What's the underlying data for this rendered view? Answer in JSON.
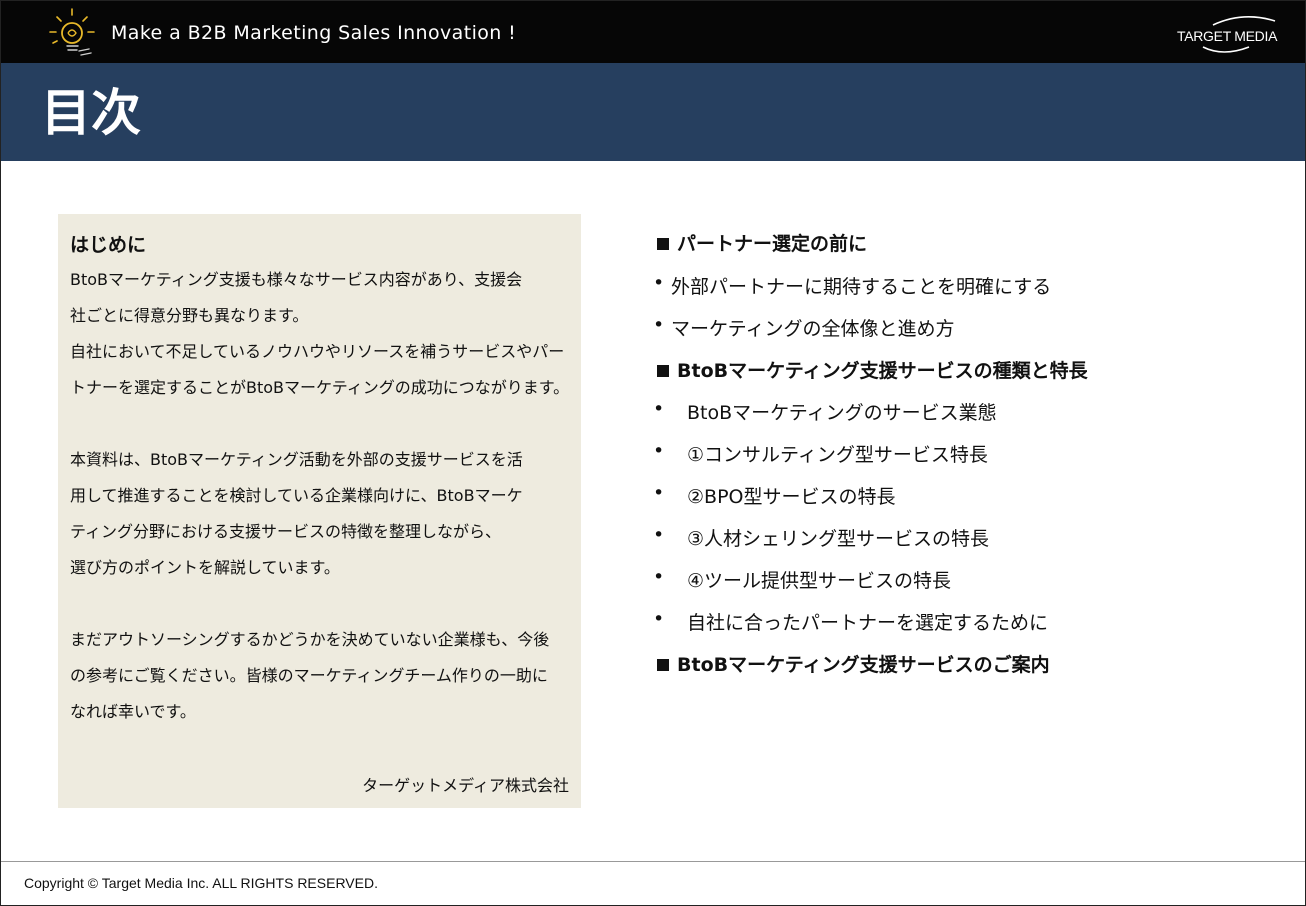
{
  "header": {
    "tagline": "Make a B2B Marketing Sales Innovation !",
    "logo_text": "TARGET MEDIA",
    "logo_icon": "lightbulb-icon"
  },
  "title": "目次",
  "intro": {
    "heading": "はじめに",
    "paragraphs": [
      [
        "BtoBマーケティング支援も様々なサービス内容があり、支援会",
        "社ごとに得意分野も異なります。",
        "自社において不足しているノウハウやリソースを補うサービスやパー",
        "トナーを選定することがBtoBマーケティングの成功につながります。"
      ],
      [
        "本資料は、BtoBマーケティング活動を外部の支援サービスを活",
        "用して推進することを検討している企業様向けに、BtoBマーケ",
        "ティング分野における支援サービスの特徴を整理しながら、",
        "選び方のポイントを解説しています。"
      ],
      [
        "まだアウトソーシングするかどうかを決めていない企業様も、今後",
        "の参考にご覧ください。皆様のマーケティングチーム作りの一助に",
        "なれば幸いです。"
      ]
    ],
    "signature": "ターゲットメディア株式会社"
  },
  "toc": [
    {
      "type": "section",
      "text": "パートナー選定の前に"
    },
    {
      "type": "bullet",
      "text": "外部パートナーに期待することを明確にする"
    },
    {
      "type": "bullet",
      "text": "マーケティングの全体像と進め方"
    },
    {
      "type": "section",
      "text": "BtoBマーケティング支援サービスの種類と特長"
    },
    {
      "type": "bullet",
      "text": "BtoBマーケティングのサービス業態"
    },
    {
      "type": "bullet",
      "text": "①コンサルティング型サービス特長"
    },
    {
      "type": "bullet",
      "text": "②BPO型サービスの特長"
    },
    {
      "type": "bullet",
      "text": "③人材シェリング型サービスの特長"
    },
    {
      "type": "bullet",
      "text": "④ツール提供型サービスの特長"
    },
    {
      "type": "bullet",
      "text": "自社に合ったパートナーを選定するために"
    },
    {
      "type": "section",
      "text": "BtoBマーケティング支援サービスのご案内"
    }
  ],
  "bullet_glyph": "•",
  "footer": {
    "copyright": "Copyright © Target Media Inc. ALL RIGHTS RESERVED."
  },
  "colors": {
    "header_bg": "#060606",
    "title_bg": "#263f5f",
    "intro_bg": "#eeebdf",
    "bulb_accent": "#e8b92a"
  }
}
